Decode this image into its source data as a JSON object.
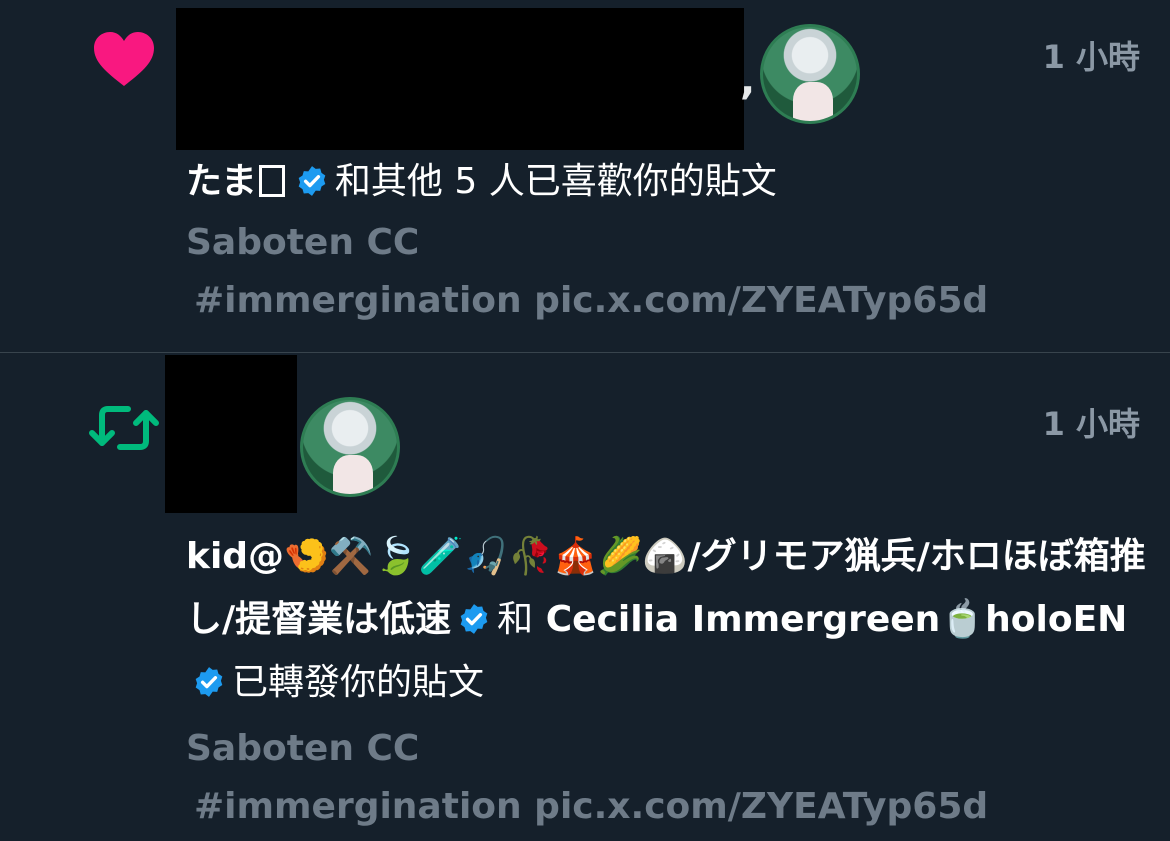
{
  "notifications": [
    {
      "type_icon": "heart-icon",
      "time": "1 小時",
      "headline": {
        "name": "たま",
        "action": "和其他 5 人已喜歡你的貼文"
      },
      "post": {
        "author": "Saboten CC",
        "text": "#immergination pic.x.com/ZYEATyp65d"
      }
    },
    {
      "type_icon": "retweet-icon",
      "time": "1 小時",
      "headline": {
        "name_part1": "kid@",
        "emojis": "🍤⚒️🍃🧪🎣🥀🎪🌽🍙",
        "name_part2": "/グリモア猟兵/ホロほぼ箱推し/提督業は低速",
        "and": "和",
        "name2_part1": "Cecilia Immergreen",
        "emoji2": "🍵",
        "name2_part2": "holoEN",
        "action": "已轉發你的貼文"
      },
      "post": {
        "author": "Saboten CC",
        "text": "#immergination pic.x.com/ZYEATyp65d"
      }
    }
  ],
  "colors": {
    "background": "#15202b",
    "heart": "#f91880",
    "retweet": "#00ba7c",
    "verified": "#1d9bf0",
    "muted": "#8b98a5"
  }
}
